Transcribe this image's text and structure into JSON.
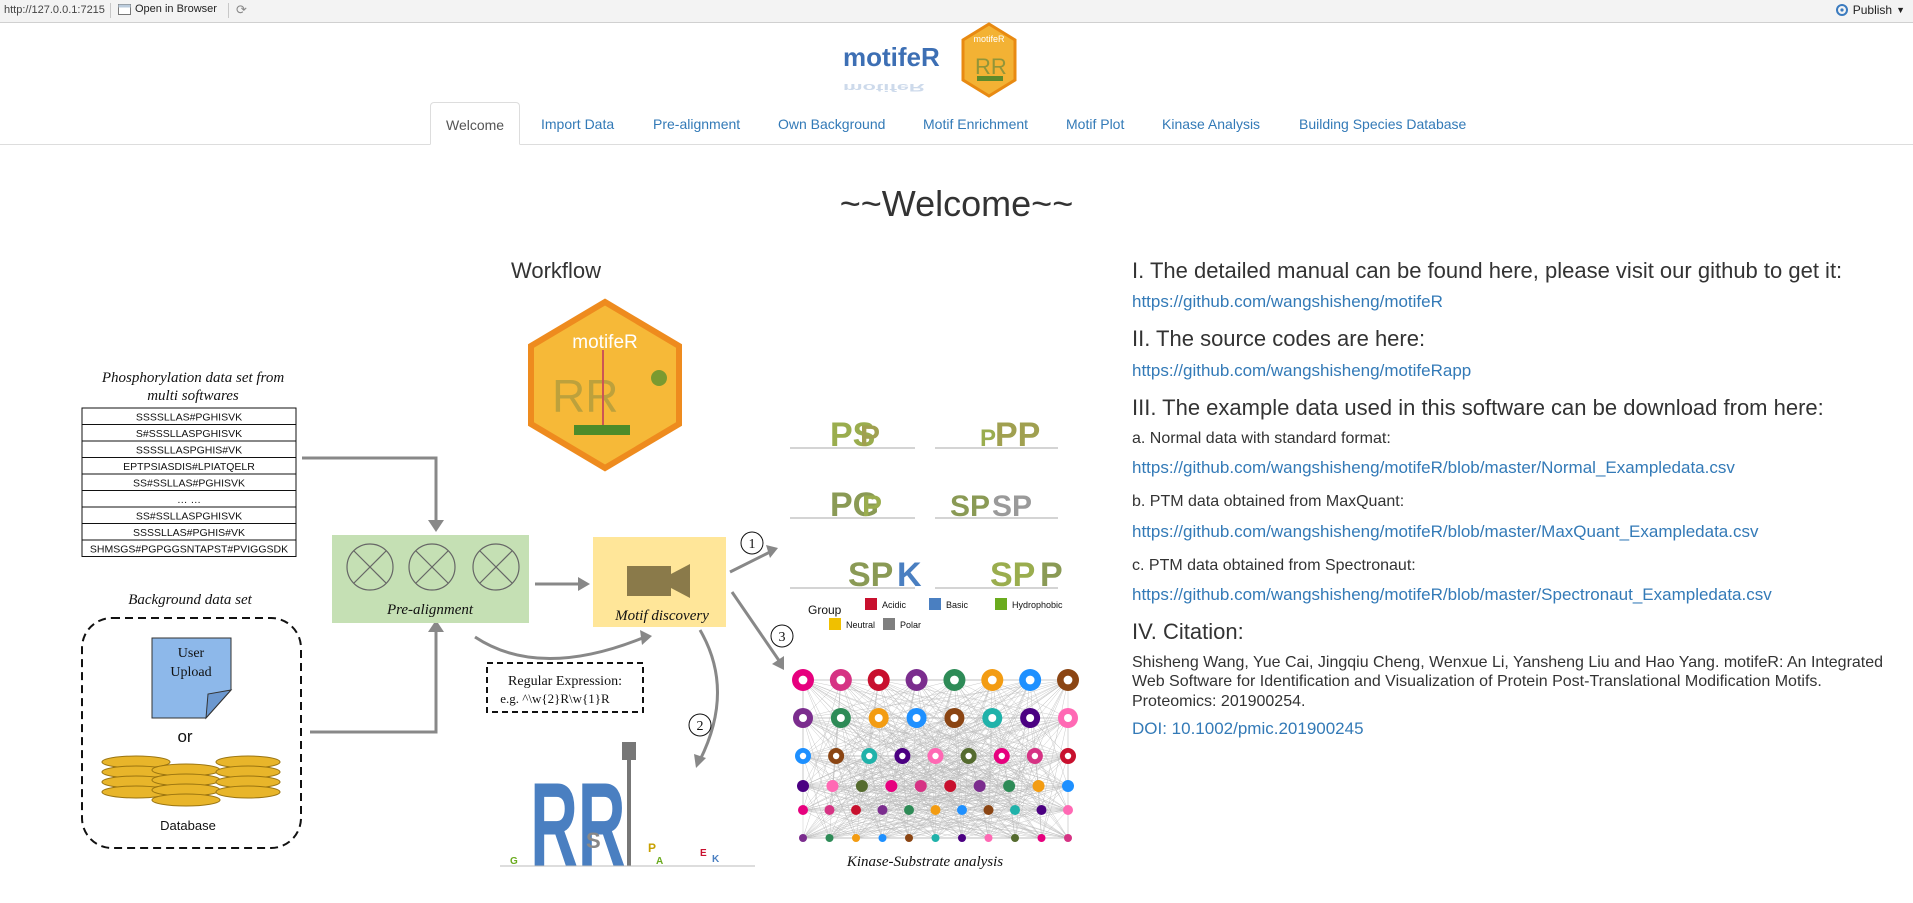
{
  "topbar": {
    "url": "http://127.0.0.1:7215",
    "open_browser": "Open in Browser",
    "publish": "Publish"
  },
  "logos": {
    "text_logo": "motifeR",
    "hex_logo_text": "motifeR"
  },
  "tabs": [
    {
      "label": "Welcome",
      "active": true
    },
    {
      "label": "Import Data"
    },
    {
      "label": "Pre-alignment"
    },
    {
      "label": "Own Background"
    },
    {
      "label": "Motif Enrichment"
    },
    {
      "label": "Motif Plot"
    },
    {
      "label": "Kinase Analysis"
    },
    {
      "label": "Building Species Database"
    }
  ],
  "main": {
    "title": "~~Welcome~~",
    "workflow_title": "Workflow"
  },
  "workflow": {
    "hex_label": "motifeR",
    "phos_title_1": "Phosphorylation data set from",
    "phos_title_2": "multi softwares",
    "peptides": [
      "SSSSLLAS#PGHISVK",
      "S#SSSLLASPGHISVK",
      "SSSSLLASPGHIS#VK",
      "EPTPSIASDIS#LPIATQELR",
      "SS#SSLLAS#PGHISVK",
      "… …",
      "SS#SSLLASPGHISVK",
      "SSSSLLAS#PGHIS#VK",
      "SHMSGS#PGPGGSNTAPST#PVIGGSDK"
    ],
    "background_title": "Background data set",
    "user_upload_1": "User",
    "user_upload_2": "Upload",
    "or": "or",
    "database": "Database",
    "prealign": "Pre-alignment",
    "motif_discovery": "Motif discovery",
    "regex_title": "Regular Expression:",
    "regex_example": "e.g. ^\\w{2}R\\w{1}R",
    "step1": "1",
    "step2": "2",
    "step3": "3",
    "group_label": "Group",
    "groups": [
      {
        "name": "Acidic",
        "color": "#c8102e"
      },
      {
        "name": "Basic",
        "color": "#4a7fc1"
      },
      {
        "name": "Hydrophobic",
        "color": "#6aab1e"
      },
      {
        "name": "Neutral",
        "color": "#f0c000"
      },
      {
        "name": "Polar",
        "color": "#7f7f7f"
      }
    ],
    "kinase_label": "Kinase-Substrate analysis"
  },
  "info": {
    "s1_title": "I. The detailed manual can be found here, please visit our github to get it:",
    "s1_link": "https://github.com/wangshisheng/motifeR",
    "s2_title": "II. The source codes are here:",
    "s2_link": "https://github.com/wangshisheng/motifeRapp",
    "s3_title": "III. The example data used in this software can be download from here:",
    "s3_a": "a. Normal data with standard format:",
    "s3_a_link": "https://github.com/wangshisheng/motifeR/blob/master/Normal_Exampledata.csv",
    "s3_b": "b. PTM data obtained from MaxQuant:",
    "s3_b_link": "https://github.com/wangshisheng/motifeR/blob/master/MaxQuant_Exampledata.csv",
    "s3_c": "c. PTM data obtained from Spectronaut:",
    "s3_c_link": "https://github.com/wangshisheng/motifeR/blob/master/Spectronaut_Exampledata.csv",
    "s4_title": "IV. Citation:",
    "citation": "Shisheng Wang, Yue Cai, Jingqiu Cheng, Wenxue Li, Yansheng Liu and Hao Yang. motifeR: An Integrated Web Software for Identification and Visualization of Protein Post-Translational Modification Motifs. Proteomics: 201900254.",
    "doi": "DOI: 10.1002/pmic.201900245"
  }
}
